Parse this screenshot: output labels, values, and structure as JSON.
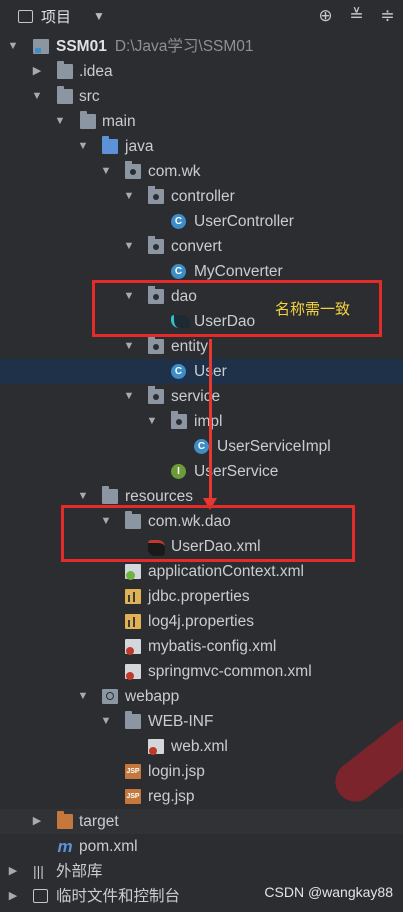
{
  "toolbar": {
    "title": "项目",
    "icons": [
      "project-view-icon",
      "chevron-down-icon",
      "locate-icon",
      "expand-all-icon",
      "collapse-all-icon"
    ]
  },
  "tree": [
    {
      "name": "SSM01",
      "path": "D:\\Java学习\\SSM01",
      "icon": "module",
      "expanded": true,
      "bold": true
    },
    {
      "name": ".idea",
      "icon": "folder",
      "expanded": false
    },
    {
      "name": "src",
      "icon": "folder",
      "expanded": true
    },
    {
      "name": "main",
      "icon": "folder",
      "expanded": true
    },
    {
      "name": "java",
      "icon": "source-folder",
      "expanded": true
    },
    {
      "name": "com.wk",
      "icon": "package",
      "expanded": true
    },
    {
      "name": "controller",
      "icon": "package",
      "expanded": true
    },
    {
      "name": "UserController",
      "icon": "class"
    },
    {
      "name": "convert",
      "icon": "package",
      "expanded": true
    },
    {
      "name": "MyConverter",
      "icon": "class"
    },
    {
      "name": "dao",
      "icon": "package",
      "expanded": true
    },
    {
      "name": "UserDao",
      "icon": "mybatis-mapper"
    },
    {
      "name": "entity",
      "icon": "package",
      "expanded": true
    },
    {
      "name": "User",
      "icon": "class",
      "selected": true
    },
    {
      "name": "service",
      "icon": "package",
      "expanded": true
    },
    {
      "name": "impl",
      "icon": "package",
      "expanded": true
    },
    {
      "name": "UserServiceImpl",
      "icon": "class"
    },
    {
      "name": "UserService",
      "icon": "interface"
    },
    {
      "name": "resources",
      "icon": "resources-folder",
      "expanded": true
    },
    {
      "name": "com.wk.dao",
      "icon": "folder",
      "expanded": true
    },
    {
      "name": "UserDao.xml",
      "icon": "mybatis-xml"
    },
    {
      "name": "applicationContext.xml",
      "icon": "spring-xml"
    },
    {
      "name": "jdbc.properties",
      "icon": "properties"
    },
    {
      "name": "log4j.properties",
      "icon": "properties"
    },
    {
      "name": "mybatis-config.xml",
      "icon": "xml"
    },
    {
      "name": "springmvc-common.xml",
      "icon": "xml"
    },
    {
      "name": "webapp",
      "icon": "web-folder",
      "expanded": true
    },
    {
      "name": "WEB-INF",
      "icon": "folder",
      "expanded": true
    },
    {
      "name": "web.xml",
      "icon": "web-xml"
    },
    {
      "name": "login.jsp",
      "icon": "jsp"
    },
    {
      "name": "reg.jsp",
      "icon": "jsp"
    },
    {
      "name": "target",
      "icon": "excluded-folder",
      "expanded": false
    },
    {
      "name": "pom.xml",
      "icon": "maven"
    },
    {
      "name": "外部库",
      "icon": "libraries",
      "expanded": false
    },
    {
      "name": "临时文件和控制台",
      "icon": "scratches",
      "expanded": false
    }
  ],
  "annotation": "名称需一致",
  "watermark": "CSDN @wangkay88",
  "colors": {
    "background": "#2b2d30",
    "selection": "#1f3049",
    "highlight_box": "#e52a2a",
    "annotation": "#f5d33e"
  }
}
